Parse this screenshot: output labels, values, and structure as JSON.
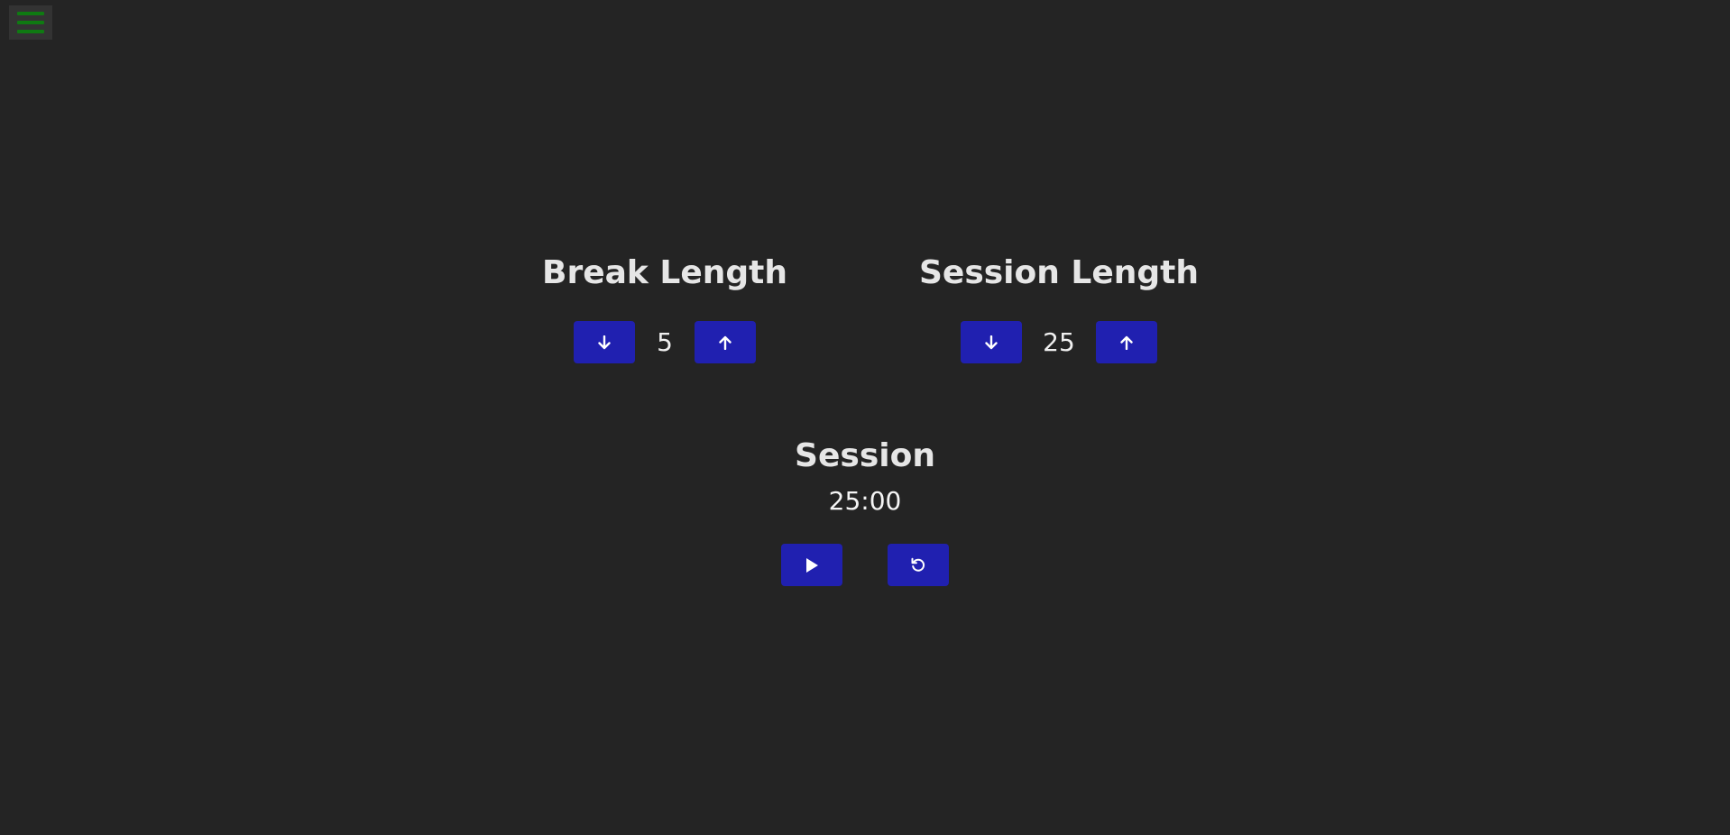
{
  "menu": {
    "icon": "hamburger-menu-icon",
    "bar_color": "#0f7a12"
  },
  "break_control": {
    "title": "Break Length",
    "value": "5",
    "decrement_icon": "arrow-down-icon",
    "increment_icon": "arrow-up-icon"
  },
  "session_control": {
    "title": "Session Length",
    "value": "25",
    "decrement_icon": "arrow-down-icon",
    "increment_icon": "arrow-up-icon"
  },
  "timer": {
    "label": "Session",
    "time": "25:00",
    "start_icon": "play-icon",
    "reset_icon": "reset-icon"
  },
  "colors": {
    "background": "#242424",
    "button": "#2020b0",
    "text": "#e6e6e6"
  }
}
